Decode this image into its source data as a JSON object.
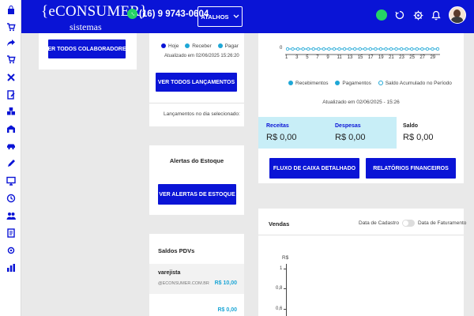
{
  "header": {
    "logo_main": "{eCONSUMER}",
    "logo_sub": "sistemas",
    "phone": "(16) 9 9743-0604",
    "shortcuts_label": "ATALHOS"
  },
  "left_col": {
    "collab_button": "VER TODOS COLABORADORES"
  },
  "mid_col": {
    "legend": [
      "Hoje",
      "Receber",
      "Pagar"
    ],
    "updated": "Atualizado em 02/06/2025 15:26:20",
    "entries_button": "VER TODOS LANÇAMENTOS",
    "entries_day_label": "Lançamentos no dia selecionado:",
    "stock_title": "Alertas do Estoque",
    "stock_button": "VER ALERTAS DE ESTOQUE",
    "pdv_title": "Saldos PDVs",
    "pdv_name": "varejista",
    "pdv_email": "@ECONSUMER.COM.BR",
    "pdv_value": "R$ 10,00",
    "pdv_value2": "R$ 0,00"
  },
  "right_col": {
    "axis_ticks": [
      "1",
      "3",
      "5",
      "7",
      "9",
      "11",
      "13",
      "15",
      "17",
      "19",
      "21",
      "23",
      "25",
      "27",
      "29"
    ],
    "axis_zero": "0",
    "legend": [
      "Recebimentos",
      "Pagamentos",
      "Saldo Acumulado no Período"
    ],
    "updated": "Atualizado em 02/06/2025 - 15:26",
    "receitas_label": "Receitas",
    "receitas_value": "R$ 0,00",
    "despesas_label": "Despesas",
    "despesas_value": "R$ 0,00",
    "saldo_label": "Saldo",
    "saldo_value": "R$ 0,00",
    "cashflow_button": "FLUXO DE CAIXA DETALHADO",
    "reports_button": "RELATÓRIOS FINANCEIROS",
    "sales_title": "Vendas",
    "toggle_left": "Data de Cadastro",
    "toggle_right": "Data de Faturamento",
    "sales_ylabel": "R$",
    "sales_ticks": [
      "1",
      "0,8",
      "0,6"
    ]
  },
  "colors": {
    "brand": "#0a14d6",
    "legend_dot": "#1ea7d6",
    "today_dot": "#0a14d6",
    "summary_bg": "#c8eef7"
  }
}
